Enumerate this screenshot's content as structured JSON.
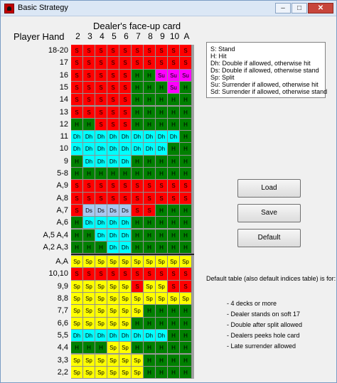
{
  "window": {
    "title": "Basic Strategy"
  },
  "header": {
    "title": "Dealer's face-up card",
    "player_hand_label": "Player Hand"
  },
  "dealer_cards": [
    "2",
    "3",
    "4",
    "5",
    "6",
    "7",
    "8",
    "9",
    "10",
    "A"
  ],
  "colors": {
    "S": "#ff0000",
    "H": "#008000",
    "Dh": "#00ffff",
    "Ds": "#a8c8f0",
    "Sp": "#ffff00",
    "Su": "#ff00ff",
    "Sp_alt": "#ff0000"
  },
  "rows": [
    {
      "label": "18-20",
      "cells": [
        "S",
        "S",
        "S",
        "S",
        "S",
        "S",
        "S",
        "S",
        "S",
        "S"
      ]
    },
    {
      "label": "17",
      "cells": [
        "S",
        "S",
        "S",
        "S",
        "S",
        "S",
        "S",
        "S",
        "S",
        "S"
      ]
    },
    {
      "label": "16",
      "cells": [
        "S",
        "S",
        "S",
        "S",
        "S",
        "H",
        "H",
        "Su",
        "Su",
        "Su"
      ]
    },
    {
      "label": "15",
      "cells": [
        "S",
        "S",
        "S",
        "S",
        "S",
        "H",
        "H",
        "H",
        "Su",
        "H"
      ]
    },
    {
      "label": "14",
      "cells": [
        "S",
        "S",
        "S",
        "S",
        "S",
        "H",
        "H",
        "H",
        "H",
        "H"
      ]
    },
    {
      "label": "13",
      "cells": [
        "S",
        "S",
        "S",
        "S",
        "S",
        "H",
        "H",
        "H",
        "H",
        "H"
      ]
    },
    {
      "label": "12",
      "cells": [
        "H",
        "H",
        "S",
        "S",
        "S",
        "H",
        "H",
        "H",
        "H",
        "H"
      ]
    },
    {
      "label": "11",
      "cells": [
        "Dh",
        "Dh",
        "Dh",
        "Dh",
        "Dh",
        "Dh",
        "Dh",
        "Dh",
        "Dh",
        "H"
      ]
    },
    {
      "label": "10",
      "cells": [
        "Dh",
        "Dh",
        "Dh",
        "Dh",
        "Dh",
        "Dh",
        "Dh",
        "Dh",
        "H",
        "H"
      ]
    },
    {
      "label": "9",
      "cells": [
        "H",
        "Dh",
        "Dh",
        "Dh",
        "Dh",
        "H",
        "H",
        "H",
        "H",
        "H"
      ]
    },
    {
      "label": "5-8",
      "cells": [
        "H",
        "H",
        "H",
        "H",
        "H",
        "H",
        "H",
        "H",
        "H",
        "H"
      ]
    },
    {
      "label": "A,9",
      "cells": [
        "S",
        "S",
        "S",
        "S",
        "S",
        "S",
        "S",
        "S",
        "S",
        "S"
      ]
    },
    {
      "label": "A,8",
      "cells": [
        "S",
        "S",
        "S",
        "S",
        "S",
        "S",
        "S",
        "S",
        "S",
        "S"
      ]
    },
    {
      "label": "A,7",
      "cells": [
        "S",
        "Ds",
        "Ds",
        "Ds",
        "Ds",
        "S",
        "S",
        "H",
        "H",
        "H"
      ]
    },
    {
      "label": "A,6",
      "cells": [
        "H",
        "Dh",
        "Dh",
        "Dh",
        "Dh",
        "H",
        "H",
        "H",
        "H",
        "H"
      ]
    },
    {
      "label": "A,5  A,4",
      "cells": [
        "H",
        "H",
        "Dh",
        "Dh",
        "Dh",
        "H",
        "H",
        "H",
        "H",
        "H"
      ]
    },
    {
      "label": "A,2  A,3",
      "cells": [
        "H",
        "H",
        "H",
        "Dh",
        "Dh",
        "H",
        "H",
        "H",
        "H",
        "H"
      ]
    },
    {
      "label": "A,A",
      "cells": [
        "Sp",
        "Sp",
        "Sp",
        "Sp",
        "Sp",
        "Sp",
        "Sp",
        "Sp",
        "Sp",
        "Sp"
      ]
    },
    {
      "label": "10,10",
      "cells": [
        "S",
        "S",
        "S",
        "S",
        "S",
        "S",
        "S",
        "S",
        "S",
        "S"
      ]
    },
    {
      "label": "9,9",
      "cells": [
        "Sp",
        "Sp",
        "Sp",
        "Sp",
        "Sp",
        "S",
        "Sp",
        "Sp",
        "S",
        "S"
      ]
    },
    {
      "label": "8,8",
      "cells": [
        "Sp",
        "Sp",
        "Sp",
        "Sp",
        "Sp",
        "Sp",
        "Sp",
        "Sp",
        "Sp",
        "Sp"
      ]
    },
    {
      "label": "7,7",
      "cells": [
        "Sp",
        "Sp",
        "Sp",
        "Sp",
        "Sp",
        "Sp",
        "H",
        "H",
        "H",
        "H"
      ]
    },
    {
      "label": "6,6",
      "cells": [
        "Sp",
        "Sp",
        "Sp",
        "Sp",
        "Sp",
        "H",
        "H",
        "H",
        "H",
        "H"
      ]
    },
    {
      "label": "5,5",
      "cells": [
        "Dh",
        "Dh",
        "Dh",
        "Dh",
        "Dh",
        "Dh",
        "Dh",
        "Dh",
        "H",
        "H"
      ]
    },
    {
      "label": "4,4",
      "cells": [
        "H",
        "H",
        "H",
        "Sp",
        "Sp",
        "H",
        "H",
        "H",
        "H",
        "H"
      ]
    },
    {
      "label": "3,3",
      "cells": [
        "Sp",
        "Sp",
        "Sp",
        "Sp",
        "Sp",
        "Sp",
        "H",
        "H",
        "H",
        "H"
      ]
    },
    {
      "label": "2,2",
      "cells": [
        "Sp",
        "Sp",
        "Sp",
        "Sp",
        "Sp",
        "Sp",
        "H",
        "H",
        "H",
        "H"
      ]
    }
  ],
  "legend": [
    "S: Stand",
    "H: Hit",
    "Dh: Double if allowed, otherwise hit",
    "Ds: Double if allowed, otherwise stand",
    "Sp: Split",
    "Su: Surrender if allowed, otherwise hit",
    "Sd: Surrender if allowed, otherwise stand"
  ],
  "buttons": {
    "load": "Load",
    "save": "Save",
    "default": "Default"
  },
  "info": {
    "heading": "Default table (also default indices table) is for:",
    "items": [
      "- 4 decks or more",
      "- Dealer stands on soft 17",
      "- Double after split allowed",
      "- Dealers peeks hole card",
      "- Late surrender allowed"
    ]
  }
}
